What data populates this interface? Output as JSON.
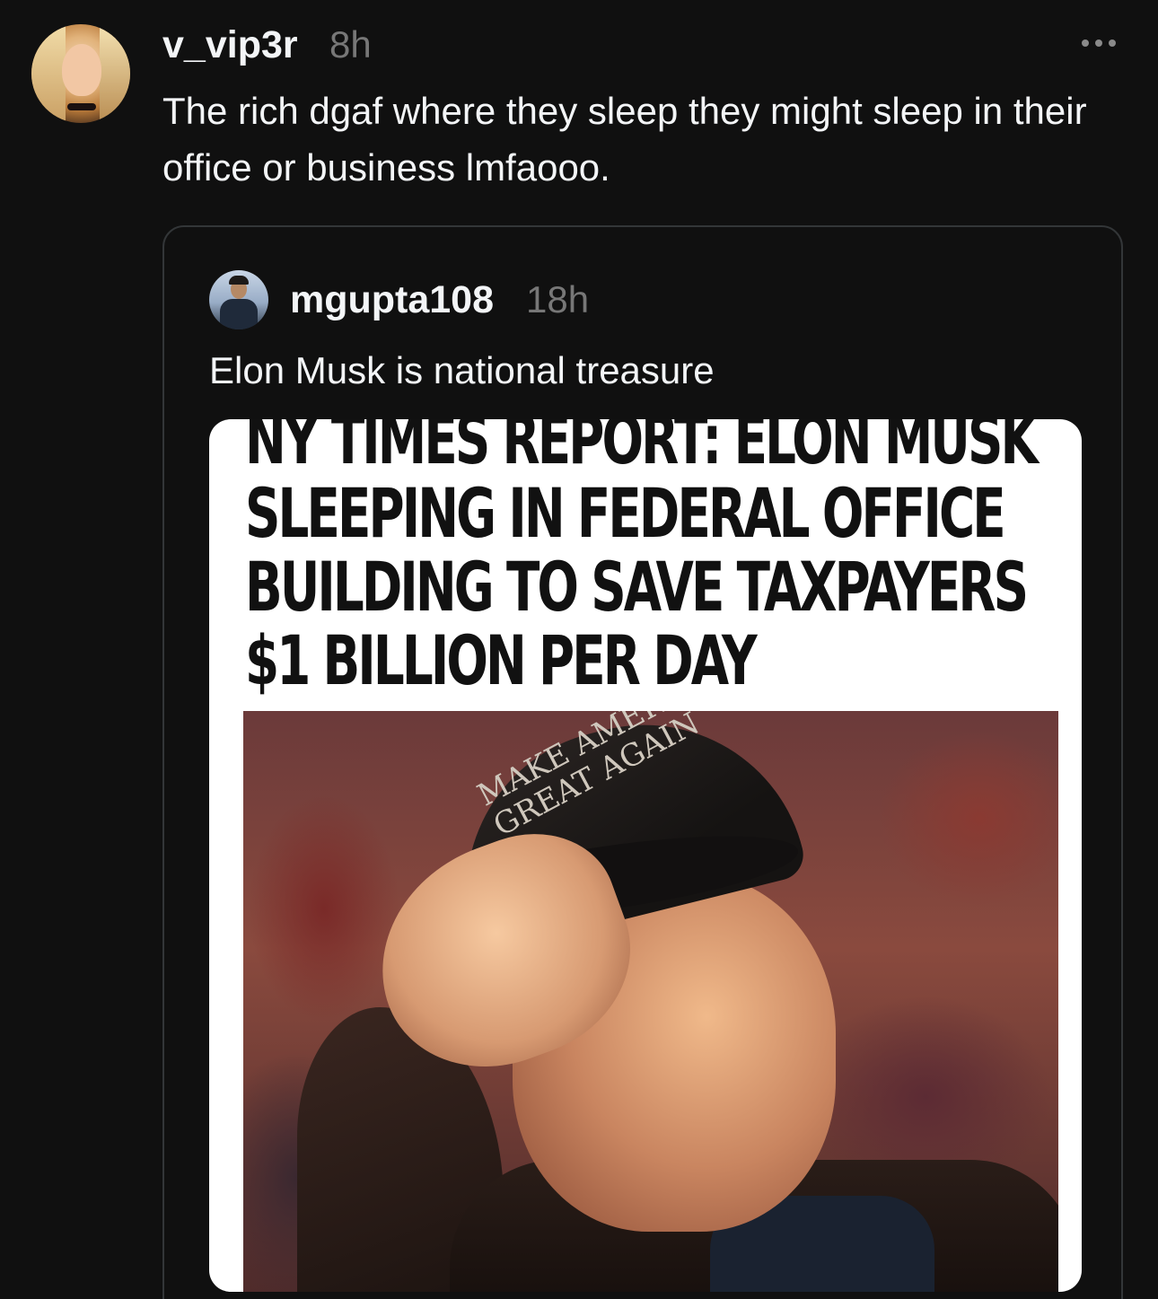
{
  "post": {
    "username": "v_vip3r",
    "time": "8h",
    "text": "The rich dgaf where they sleep they might sleep in their office or business lmfaooo.",
    "avatar_icon": "avatar-icon"
  },
  "quoted_post": {
    "username": "mgupta108",
    "time": "18h",
    "text": "Elon Musk is national treasure",
    "image": {
      "headline_lines": [
        "NY TIMES REPORT: ELON MUSK",
        "SLEEPING IN FEDERAL OFFICE",
        "BUILDING TO SAVE TAXPAYERS",
        "$1 BILLION PER DAY"
      ],
      "cap_text_lines": [
        "MAKE AMERICA",
        "GREAT AGAIN"
      ]
    }
  },
  "colors": {
    "background": "#101010",
    "text_primary": "#f3f5f7",
    "text_secondary": "#777777",
    "card_border": "#333638"
  }
}
